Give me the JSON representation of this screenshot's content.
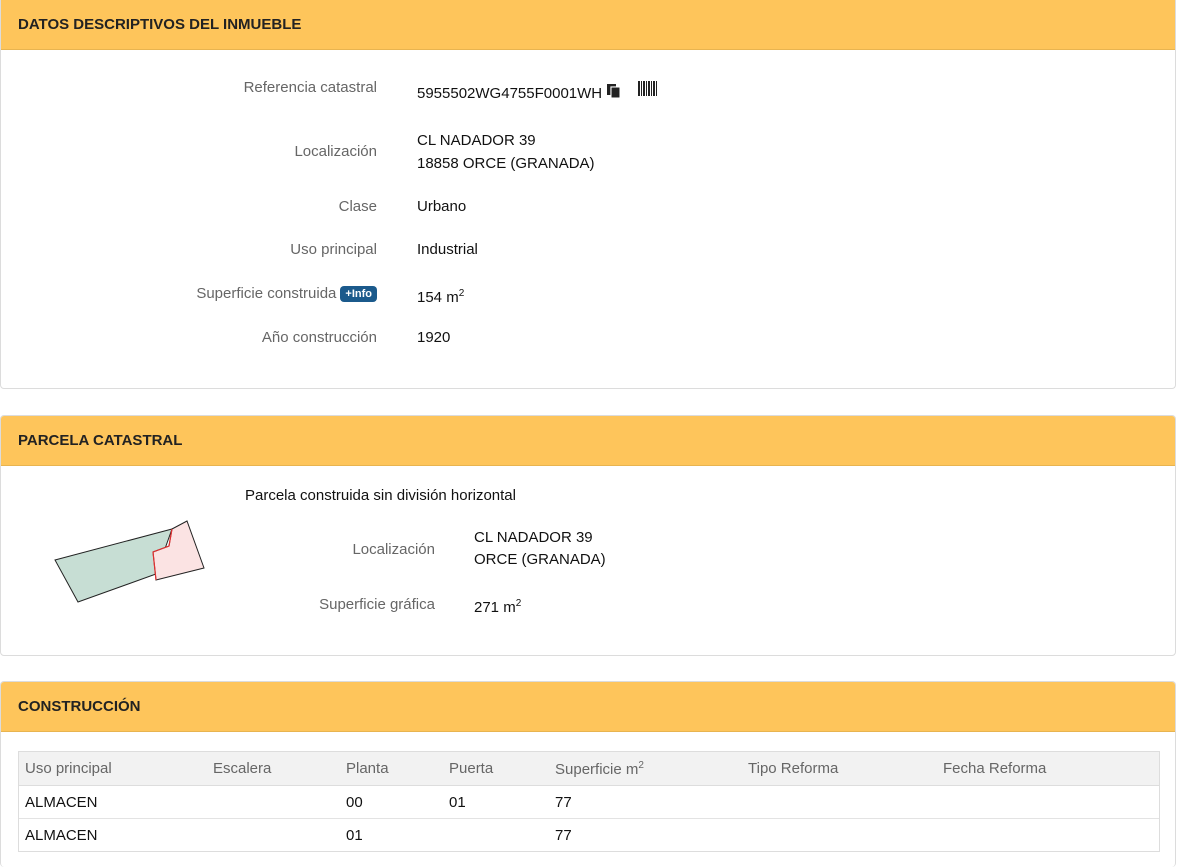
{
  "datos": {
    "title": "DATOS DESCRIPTIVOS DEL INMUEBLE",
    "referencia_label": "Referencia catastral",
    "referencia_value": "5955502WG4755F0001WH",
    "localizacion_label": "Localización",
    "localizacion_line1": "CL NADADOR 39",
    "localizacion_line2": "18858 ORCE (GRANADA)",
    "clase_label": "Clase",
    "clase_value": "Urbano",
    "uso_label": "Uso principal",
    "uso_value": "Industrial",
    "superficie_label": "Superficie construida",
    "info_badge": "+Info",
    "superficie_value": "154 m",
    "superficie_unit_sup": "2",
    "anio_label": "Año construcción",
    "anio_value": "1920"
  },
  "parcela": {
    "title": "PARCELA CATASTRAL",
    "subtitle": "Parcela construida sin división horizontal",
    "localizacion_label": "Localización",
    "localizacion_line1": "CL NADADOR 39",
    "localizacion_line2": "ORCE (GRANADA)",
    "superficie_label": "Superficie gráfica",
    "superficie_value": "271 m",
    "superficie_unit_sup": "2",
    "map_colors": {
      "main_fill": "#c7ded4",
      "sub_fill": "#fbe3e3",
      "boundary": "#e23030"
    }
  },
  "construccion": {
    "title": "CONSTRUCCIÓN",
    "headers": {
      "uso": "Uso principal",
      "escalera": "Escalera",
      "planta": "Planta",
      "puerta": "Puerta",
      "superficie": "Superficie m",
      "superficie_sup": "2",
      "tipo": "Tipo Reforma",
      "fecha": "Fecha Reforma"
    },
    "rows": [
      {
        "uso": "ALMACEN",
        "escalera": "",
        "planta": "00",
        "puerta": "01",
        "superficie": "77",
        "tipo": "",
        "fecha": ""
      },
      {
        "uso": "ALMACEN",
        "escalera": "",
        "planta": "01",
        "puerta": "",
        "superficie": "77",
        "tipo": "",
        "fecha": ""
      }
    ]
  },
  "icons": [
    "copy-icon",
    "barcode-icon"
  ]
}
